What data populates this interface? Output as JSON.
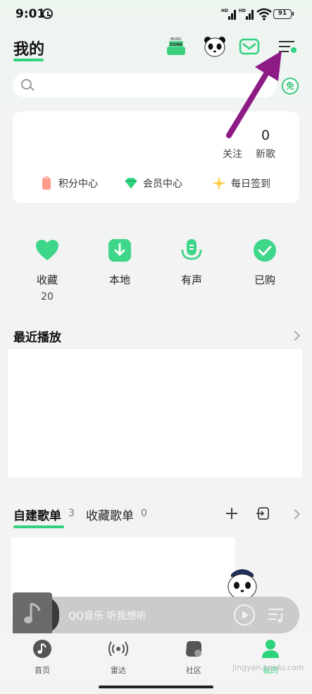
{
  "status_bar": {
    "time": "9:01",
    "signal_tag_1": "HD",
    "signal_tag_2": "HD",
    "battery": "91"
  },
  "header": {
    "title": "我的"
  },
  "search": {
    "placeholder": "",
    "badge": "免"
  },
  "user_card": {
    "stats": [
      {
        "value": "",
        "label": "关注"
      },
      {
        "value": "0",
        "label": "新歌"
      }
    ],
    "shortcuts": [
      {
        "label": "积分中心",
        "icon": "points-icon"
      },
      {
        "label": "会员中心",
        "icon": "diamond-icon"
      },
      {
        "label": "每日签到",
        "icon": "sparkle-icon"
      }
    ]
  },
  "quick_actions": [
    {
      "label": "收藏",
      "count": "20",
      "icon": "heart-icon"
    },
    {
      "label": "本地",
      "count": "",
      "icon": "download-icon"
    },
    {
      "label": "有声",
      "count": "",
      "icon": "microphone-icon"
    },
    {
      "label": "已购",
      "count": "",
      "icon": "check-icon"
    }
  ],
  "recent": {
    "title": "最近播放"
  },
  "playlists": {
    "created_label": "自建歌单",
    "created_count": "3",
    "collected_label": "收藏歌单",
    "collected_count": "0"
  },
  "player": {
    "text": "QQ音乐 听我想听"
  },
  "bottom_nav": [
    {
      "label": "首页",
      "icon": "music-note-icon"
    },
    {
      "label": "雷达",
      "icon": "radar-icon"
    },
    {
      "label": "社区",
      "icon": "community-icon"
    },
    {
      "label": "我的",
      "icon": "profile-icon"
    }
  ],
  "watermark": "jingyan.baidu.com",
  "colors": {
    "accent": "#2fd37e",
    "annotation": "#8e1a86"
  }
}
